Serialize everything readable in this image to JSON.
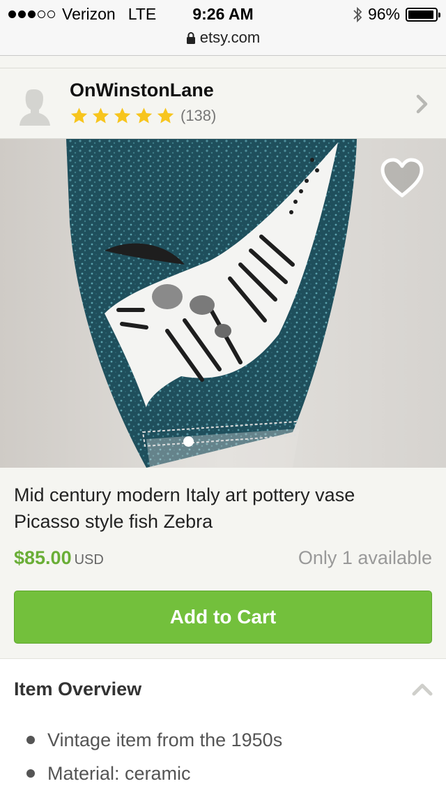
{
  "status_bar": {
    "carrier": "Verizon",
    "network": "LTE",
    "time": "9:26 AM",
    "battery": "96%",
    "battery_level": 0.96,
    "signal_bars": 3,
    "signal_total": 5
  },
  "browser": {
    "url": "etsy.com"
  },
  "shop": {
    "name": "OnWinstonLane",
    "rating_stars": 5,
    "review_count": "(138)"
  },
  "listing": {
    "title_line1": "Mid century modern Italy art pottery vase",
    "title_line2": "Picasso style fish Zebra",
    "price": "$85.00",
    "currency": "USD",
    "availability": "Only 1 available",
    "add_to_cart_label": "Add to Cart",
    "image_count": 1,
    "current_image": 1
  },
  "overview": {
    "heading": "Item Overview",
    "items": [
      "Vintage item from the 1950s",
      "Material: ceramic"
    ]
  },
  "colors": {
    "accent_green": "#73c03c",
    "price_green": "#6aae37",
    "star_yellow": "#f7c51e"
  }
}
